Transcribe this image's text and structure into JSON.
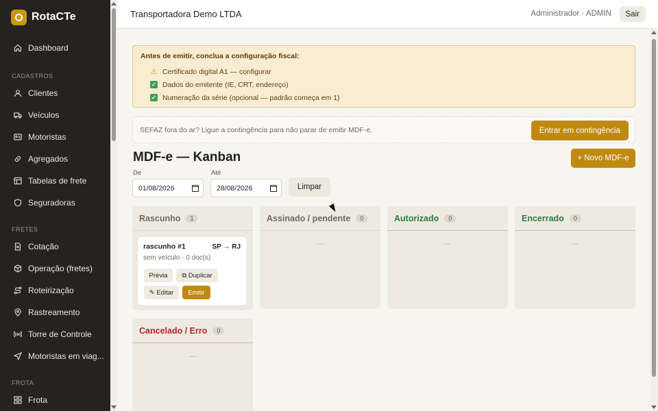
{
  "brand": {
    "name": "RotaCTe"
  },
  "sidebar": {
    "items": [
      {
        "label": "Dashboard",
        "icon": "home-icon"
      }
    ],
    "sections": [
      {
        "title": "CADASTROS",
        "items": [
          {
            "label": "Clientes",
            "icon": "user-icon"
          },
          {
            "label": "Veículos",
            "icon": "truck-icon"
          },
          {
            "label": "Motoristas",
            "icon": "id-card-icon"
          },
          {
            "label": "Agregados",
            "icon": "link-icon"
          },
          {
            "label": "Tabelas de frete",
            "icon": "table-icon"
          },
          {
            "label": "Seguradoras",
            "icon": "shield-icon"
          }
        ]
      },
      {
        "title": "FRETES",
        "items": [
          {
            "label": "Cotação",
            "icon": "document-icon"
          },
          {
            "label": "Operação (fretes)",
            "icon": "package-icon"
          },
          {
            "label": "Roteirização",
            "icon": "route-icon"
          },
          {
            "label": "Rastreamento",
            "icon": "map-pin-icon"
          },
          {
            "label": "Torre de Controle",
            "icon": "broadcast-icon"
          },
          {
            "label": "Motoristas em viag...",
            "icon": "navigation-icon"
          }
        ]
      },
      {
        "title": "FROTA",
        "items": [
          {
            "label": "Frota",
            "icon": "grid-icon"
          }
        ]
      }
    ]
  },
  "header": {
    "company": "Transportadora Demo LTDA",
    "user": "Administrador · ADMIN",
    "logout": "Sair"
  },
  "alert": {
    "title": "Antes de emitir, conclua a configuração fiscal:",
    "items": [
      {
        "icon": "warning-icon",
        "text": "Certificado digital A1 — configurar"
      },
      {
        "icon": "check-icon",
        "text": "Dados do emitente (IE, CRT, endereço)"
      },
      {
        "icon": "check-icon",
        "text": "Numeração da série (opcional — padrão começa em 1)"
      }
    ]
  },
  "contingency": {
    "text": "SEFAZ fora do ar? Ligue a contingência para não parar de emitir MDF-e.",
    "button": "Entrar em contingência"
  },
  "page": {
    "title": "MDF-e — Kanban",
    "new_button": "+ Novo MDF-e"
  },
  "filters": {
    "from_label": "De",
    "from_value": "01/08/2026",
    "to_label": "Até",
    "to_value": "28/08/2026",
    "clear": "Limpar"
  },
  "kanban": {
    "columns": [
      {
        "title": "Rascunho",
        "count": "1",
        "color": "#6f6b64",
        "line": "#dcd7cb"
      },
      {
        "title": "Assinado / pendente",
        "count": "0",
        "color": "#6f6b64",
        "line": "#dcd7cb",
        "empty": "—"
      },
      {
        "title": "Autorizado",
        "count": "0",
        "color": "#2f7d43",
        "line": "#a8d6b2",
        "empty": "—"
      },
      {
        "title": "Encerrado",
        "count": "0",
        "color": "#2f7d43",
        "line": "#a8d6b2",
        "empty": "—"
      },
      {
        "title": "Cancelado / Erro",
        "count": "0",
        "color": "#b3262c",
        "line": "#ecaaa6",
        "empty": "—"
      }
    ],
    "card": {
      "title": "rascunho #1",
      "route": "SP → RJ",
      "sub": "sem veículo · 0 doc(s)",
      "preview": "Prévia",
      "duplicate": "⧉ Duplicar",
      "edit": "✎ Editar",
      "emit": "Emitir"
    }
  }
}
